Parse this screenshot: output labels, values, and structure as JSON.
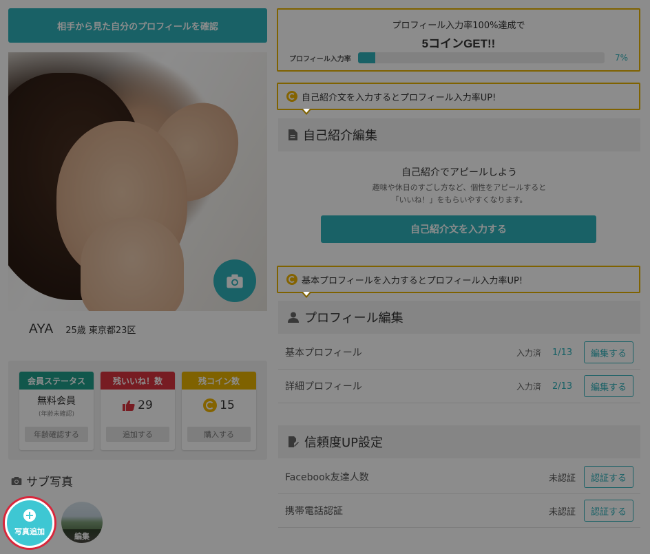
{
  "header": {
    "confirm_button": "相手から見た自分のプロフィールを確認"
  },
  "profile": {
    "name": "AYA",
    "age_location": "25歳 東京都23区"
  },
  "status": {
    "member": {
      "header": "会員ステータス",
      "value": "無料会員",
      "sub": "(年齢未確認)",
      "action": "年齢確認する",
      "color": "#1f9e8a"
    },
    "likes": {
      "header": "残いいね！数",
      "value": "29",
      "action": "追加する",
      "color": "#d9343e"
    },
    "coins": {
      "header": "残コイン数",
      "value": "15",
      "action": "購入する",
      "color": "#e8b200"
    }
  },
  "sub_photos": {
    "title": "サブ写真",
    "add_label": "写真追加",
    "edit_label": "編集"
  },
  "progress": {
    "line1": "プロフィール入力率100%達成で",
    "line2": "5コインGET!!",
    "label": "プロフィール入力率",
    "percent_text": "7%",
    "percent": 7
  },
  "intro_tip": "自己紹介文を入力するとプロフィール入力率UP!",
  "intro": {
    "title": "自己紹介編集",
    "heading": "自己紹介でアピールしよう",
    "desc1": "趣味や休日のすごし方など、個性をアピールすると",
    "desc2": "「いいね！」をもらいやすくなります。",
    "button": "自己紹介文を入力する"
  },
  "basic_tip": "基本プロフィールを入力するとプロフィール入力率UP!",
  "profile_edit": {
    "title": "プロフィール編集",
    "rows": [
      {
        "label": "基本プロフィール",
        "state": "入力済",
        "count": "1/13",
        "button": "編集する"
      },
      {
        "label": "詳細プロフィール",
        "state": "入力済",
        "count": "2/13",
        "button": "編集する"
      }
    ]
  },
  "trust": {
    "title": "信頼度UP設定",
    "rows": [
      {
        "label": "Facebook友達人数",
        "state": "未認証",
        "button": "認証する"
      },
      {
        "label": "携帯電話認証",
        "state": "未認証",
        "button": "認証する"
      }
    ]
  },
  "colors": {
    "accent": "#2fb1bb",
    "highlight": "#e8b200",
    "alert": "#d9263b"
  }
}
